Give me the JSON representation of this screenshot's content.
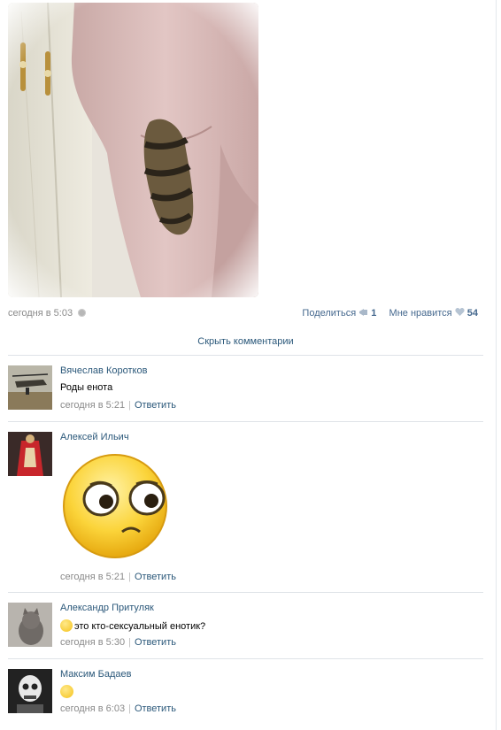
{
  "post": {
    "timestamp": "сегодня в 5:03",
    "share_label": "Поделиться",
    "share_count": "1",
    "like_label": "Мне нравится",
    "like_count": "54"
  },
  "hide_comments_label": "Скрыть комментарии",
  "comments": [
    {
      "author": "Вячеслав Коротков",
      "text": "Роды енота",
      "time": "сегодня в 5:21",
      "reply": "Ответить"
    },
    {
      "author": "Алексей Ильич",
      "text": "",
      "time": "сегодня в 5:21",
      "reply": "Ответить"
    },
    {
      "author": "Александр Притуляк",
      "text": "это кто-сексуальный енотик?",
      "time": "сегодня в 5:30",
      "reply": "Ответить"
    },
    {
      "author": "Максим Бадаев",
      "text": "",
      "time": "сегодня в 6:03",
      "reply": "Ответить"
    }
  ],
  "icons": {
    "settings": "gear-icon",
    "share": "megaphone-icon",
    "like": "heart-icon",
    "emoji": "smiley-icon",
    "sticker": "confused-smiley-sticker"
  },
  "colors": {
    "link": "#2b587a",
    "meta_text": "#8a8a8a",
    "divider": "#dfe3e8",
    "sticker_yellow": "#f5c21a"
  }
}
